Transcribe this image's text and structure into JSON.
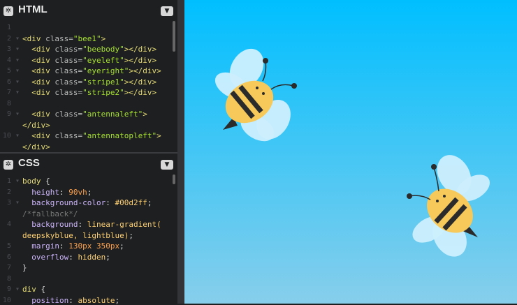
{
  "html_panel": {
    "title": "HTML",
    "settings_icon": "gear-icon",
    "collapse_icon": "chevron-down-icon",
    "lines": [
      {
        "num": "1",
        "fold": false,
        "parts": [
          {
            "t": "",
            "c": "t-plain"
          }
        ]
      },
      {
        "num": "2",
        "fold": true,
        "parts": [
          {
            "t": "<div",
            "c": "t-tag"
          },
          {
            "t": " class=",
            "c": "t-attr"
          },
          {
            "t": "\"bee1\"",
            "c": "t-str"
          },
          {
            "t": ">",
            "c": "t-tag"
          }
        ]
      },
      {
        "num": "3",
        "fold": true,
        "parts": [
          {
            "t": "  <div",
            "c": "t-tag"
          },
          {
            "t": " class=",
            "c": "t-attr"
          },
          {
            "t": "\"beebody\"",
            "c": "t-str"
          },
          {
            "t": "></div>",
            "c": "t-tag"
          }
        ]
      },
      {
        "num": "4",
        "fold": true,
        "parts": [
          {
            "t": "  <div",
            "c": "t-tag"
          },
          {
            "t": " class=",
            "c": "t-attr"
          },
          {
            "t": "\"eyeleft\"",
            "c": "t-str"
          },
          {
            "t": "></div>",
            "c": "t-tag"
          }
        ]
      },
      {
        "num": "5",
        "fold": true,
        "parts": [
          {
            "t": "  <div",
            "c": "t-tag"
          },
          {
            "t": " class=",
            "c": "t-attr"
          },
          {
            "t": "\"eyeright\"",
            "c": "t-str"
          },
          {
            "t": "></div>",
            "c": "t-tag"
          }
        ]
      },
      {
        "num": "6",
        "fold": true,
        "parts": [
          {
            "t": "  <div",
            "c": "t-tag"
          },
          {
            "t": " class=",
            "c": "t-attr"
          },
          {
            "t": "\"stripe1\"",
            "c": "t-str"
          },
          {
            "t": "></div>",
            "c": "t-tag"
          }
        ]
      },
      {
        "num": "7",
        "fold": true,
        "parts": [
          {
            "t": "  <div",
            "c": "t-tag"
          },
          {
            "t": " class=",
            "c": "t-attr"
          },
          {
            "t": "\"stripe2\"",
            "c": "t-str"
          },
          {
            "t": "></div>",
            "c": "t-tag"
          }
        ]
      },
      {
        "num": "8",
        "fold": false,
        "parts": [
          {
            "t": "",
            "c": "t-plain"
          }
        ]
      },
      {
        "num": "9",
        "fold": true,
        "parts": [
          {
            "t": "  <div",
            "c": "t-tag"
          },
          {
            "t": " class=",
            "c": "t-attr"
          },
          {
            "t": "\"antennaleft\"",
            "c": "t-str"
          },
          {
            "t": ">",
            "c": "t-tag"
          }
        ]
      },
      {
        "num": "",
        "fold": false,
        "parts": [
          {
            "t": "</div>",
            "c": "t-tag"
          }
        ]
      },
      {
        "num": "10",
        "fold": true,
        "parts": [
          {
            "t": "  <div",
            "c": "t-tag"
          },
          {
            "t": " class=",
            "c": "t-attr"
          },
          {
            "t": "\"antennatopleft\"",
            "c": "t-str"
          },
          {
            "t": ">",
            "c": "t-tag"
          }
        ]
      },
      {
        "num": "",
        "fold": false,
        "parts": [
          {
            "t": "</div>",
            "c": "t-tag"
          }
        ]
      }
    ]
  },
  "css_panel": {
    "title": "CSS",
    "settings_icon": "gear-icon",
    "collapse_icon": "chevron-down-icon",
    "lines": [
      {
        "num": "1",
        "fold": true,
        "parts": [
          {
            "t": "body",
            "c": "t-sel"
          },
          {
            "t": " {",
            "c": "t-plain"
          }
        ]
      },
      {
        "num": "2",
        "fold": false,
        "parts": [
          {
            "t": "  height",
            "c": "t-prop"
          },
          {
            "t": ": ",
            "c": "t-plain"
          },
          {
            "t": "90vh",
            "c": "t-num"
          },
          {
            "t": ";",
            "c": "t-plain"
          }
        ]
      },
      {
        "num": "3",
        "fold": true,
        "parts": [
          {
            "t": "  background-color",
            "c": "t-prop"
          },
          {
            "t": ": ",
            "c": "t-plain"
          },
          {
            "t": "#00d2ff",
            "c": "t-val"
          },
          {
            "t": ";",
            "c": "t-plain"
          }
        ]
      },
      {
        "num": "",
        "fold": false,
        "parts": [
          {
            "t": "/*fallback*/",
            "c": "t-com"
          }
        ]
      },
      {
        "num": "4",
        "fold": false,
        "parts": [
          {
            "t": "  background",
            "c": "t-prop"
          },
          {
            "t": ": ",
            "c": "t-plain"
          },
          {
            "t": "linear-gradient(",
            "c": "t-val"
          }
        ]
      },
      {
        "num": "",
        "fold": false,
        "parts": [
          {
            "t": "deepskyblue, lightblue)",
            "c": "t-val"
          },
          {
            "t": ";",
            "c": "t-plain"
          }
        ]
      },
      {
        "num": "5",
        "fold": false,
        "parts": [
          {
            "t": "  margin",
            "c": "t-prop"
          },
          {
            "t": ": ",
            "c": "t-plain"
          },
          {
            "t": "130px 350px",
            "c": "t-num"
          },
          {
            "t": ";",
            "c": "t-plain"
          }
        ]
      },
      {
        "num": "6",
        "fold": false,
        "parts": [
          {
            "t": "  overflow",
            "c": "t-prop"
          },
          {
            "t": ": ",
            "c": "t-plain"
          },
          {
            "t": "hidden",
            "c": "t-val"
          },
          {
            "t": ";",
            "c": "t-plain"
          }
        ]
      },
      {
        "num": "7",
        "fold": false,
        "parts": [
          {
            "t": "}",
            "c": "t-plain"
          }
        ]
      },
      {
        "num": "8",
        "fold": false,
        "parts": [
          {
            "t": "",
            "c": "t-plain"
          }
        ]
      },
      {
        "num": "9",
        "fold": true,
        "parts": [
          {
            "t": "div",
            "c": "t-sel"
          },
          {
            "t": " {",
            "c": "t-plain"
          }
        ]
      },
      {
        "num": "10",
        "fold": false,
        "parts": [
          {
            "t": "  position",
            "c": "t-prop"
          },
          {
            "t": ": ",
            "c": "t-plain"
          },
          {
            "t": "absolute",
            "c": "t-val"
          },
          {
            "t": ";",
            "c": "t-plain"
          }
        ]
      }
    ]
  },
  "preview": {
    "gradient_top": "#00bfff",
    "gradient_bottom": "#87ceeb",
    "bee_body_color": "#f6c95a",
    "stripe_color": "#2b2b2b",
    "wing_color": "#cdeffd"
  }
}
